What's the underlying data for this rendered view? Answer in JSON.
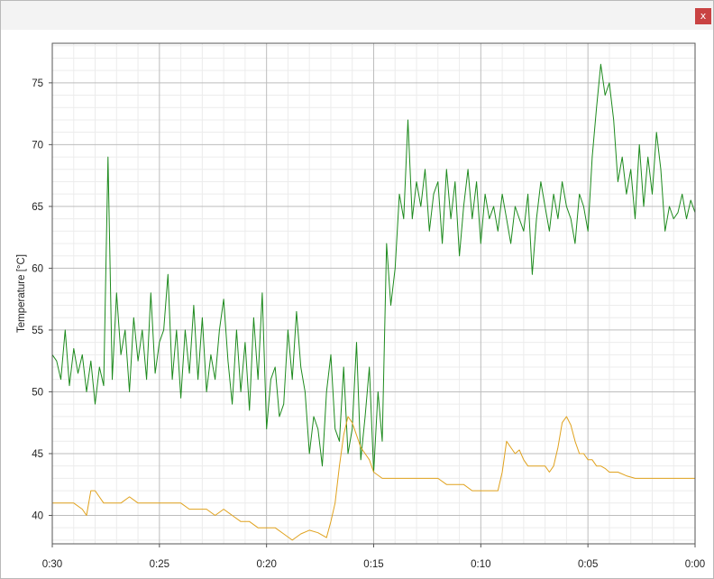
{
  "window": {
    "close_label": "x"
  },
  "colors": {
    "green_series": "#1d8a1d",
    "orange_series": "#e0a21e",
    "grid_major": "#bdbdbd",
    "grid_minor": "#ececec",
    "plot_border": "#555555"
  },
  "chart_data": {
    "type": "line",
    "title": "",
    "xlabel": "",
    "ylabel": "Temperature [°C]",
    "x_reversed": true,
    "xlim": [
      30,
      0
    ],
    "ylim": [
      37.7,
      78.2
    ],
    "x_ticks": [
      30,
      25,
      20,
      15,
      10,
      5,
      0
    ],
    "x_tick_labels": [
      "0:30",
      "0:25",
      "0:20",
      "0:15",
      "0:10",
      "0:05",
      "0:00"
    ],
    "y_ticks": [
      40,
      45,
      50,
      55,
      60,
      65,
      70,
      75
    ],
    "y_tick_labels": [
      "40",
      "45",
      "50",
      "55",
      "60",
      "65",
      "70",
      "75"
    ],
    "grid": true,
    "series": [
      {
        "color": "#1d8a1d",
        "x": [
          30,
          29.8,
          29.6,
          29.4,
          29.2,
          29.0,
          28.8,
          28.6,
          28.4,
          28.2,
          28.0,
          27.8,
          27.6,
          27.4,
          27.2,
          27.0,
          26.8,
          26.6,
          26.4,
          26.2,
          26.0,
          25.8,
          25.6,
          25.4,
          25.2,
          25.0,
          24.8,
          24.6,
          24.4,
          24.2,
          24.0,
          23.8,
          23.6,
          23.4,
          23.2,
          23.0,
          22.8,
          22.6,
          22.4,
          22.2,
          22.0,
          21.8,
          21.6,
          21.4,
          21.2,
          21.0,
          20.8,
          20.6,
          20.4,
          20.2,
          20.0,
          19.8,
          19.6,
          19.4,
          19.2,
          19.0,
          18.8,
          18.6,
          18.4,
          18.2,
          18.0,
          17.8,
          17.6,
          17.4,
          17.2,
          17.0,
          16.8,
          16.6,
          16.4,
          16.2,
          16.0,
          15.8,
          15.6,
          15.4,
          15.2,
          15.0,
          14.8,
          14.6,
          14.4,
          14.2,
          14.0,
          13.8,
          13.6,
          13.4,
          13.2,
          13.0,
          12.8,
          12.6,
          12.4,
          12.2,
          12.0,
          11.8,
          11.6,
          11.4,
          11.2,
          11.0,
          10.8,
          10.6,
          10.4,
          10.2,
          10.0,
          9.8,
          9.6,
          9.4,
          9.2,
          9.0,
          8.8,
          8.6,
          8.4,
          8.2,
          8.0,
          7.8,
          7.6,
          7.4,
          7.2,
          7.0,
          6.8,
          6.6,
          6.4,
          6.2,
          6.0,
          5.8,
          5.6,
          5.4,
          5.2,
          5.0,
          4.8,
          4.6,
          4.4,
          4.2,
          4.0,
          3.8,
          3.6,
          3.4,
          3.2,
          3.0,
          2.8,
          2.6,
          2.4,
          2.2,
          2.0,
          1.8,
          1.6,
          1.4,
          1.2,
          1.0,
          0.8,
          0.6,
          0.4,
          0.2,
          0.0
        ],
        "y": [
          53,
          52.5,
          51,
          55,
          50.5,
          53.5,
          51.5,
          53,
          50,
          52.5,
          49,
          52,
          50.5,
          69,
          51,
          58,
          53,
          55,
          50,
          56,
          52.5,
          55,
          51,
          58,
          51.5,
          54,
          55,
          59.5,
          51,
          55,
          49.5,
          55,
          51.5,
          57,
          51,
          56,
          50,
          53,
          51,
          55,
          57.5,
          52.5,
          49,
          55,
          50,
          54,
          48.5,
          56,
          51,
          58,
          47,
          51,
          52,
          48,
          49,
          55,
          51,
          56.5,
          52,
          50,
          45,
          48,
          47,
          44,
          50,
          53,
          47,
          46,
          52,
          45,
          47,
          54,
          44.5,
          48,
          52,
          43.5,
          50,
          46,
          62,
          57,
          60,
          66,
          64,
          72,
          64,
          67,
          65,
          68,
          63,
          66,
          67,
          62,
          68,
          64,
          67,
          61,
          65,
          68,
          64,
          67,
          62,
          66,
          64,
          65,
          63,
          66,
          64,
          62,
          65,
          64,
          63,
          66,
          59.5,
          64,
          67,
          65,
          63,
          66,
          64,
          67,
          65,
          64,
          62,
          66,
          65,
          63,
          69,
          73,
          76.5,
          74,
          75,
          72,
          67,
          69,
          66,
          68,
          64,
          70,
          65,
          69,
          66,
          71,
          68,
          63,
          65,
          64,
          64.5,
          66,
          64,
          65.5,
          64.5
        ]
      },
      {
        "color": "#e0a21e",
        "x": [
          30,
          29.5,
          29.0,
          28.6,
          28.4,
          28.2,
          28.0,
          27.6,
          27.2,
          26.8,
          26.4,
          26.0,
          25.6,
          25.2,
          24.8,
          24.4,
          24.0,
          23.6,
          23.2,
          22.8,
          22.4,
          22.0,
          21.6,
          21.2,
          20.8,
          20.4,
          20.0,
          19.6,
          19.2,
          18.8,
          18.4,
          18.0,
          17.6,
          17.2,
          17.0,
          16.8,
          16.6,
          16.4,
          16.2,
          16.0,
          15.8,
          15.6,
          15.4,
          15.2,
          15.0,
          14.6,
          14.0,
          13.6,
          13.2,
          12.8,
          12.4,
          12.0,
          11.6,
          11.2,
          10.8,
          10.4,
          10.0,
          9.6,
          9.2,
          9.0,
          8.8,
          8.6,
          8.4,
          8.2,
          8.0,
          7.8,
          7.6,
          7.4,
          7.2,
          7.0,
          6.8,
          6.6,
          6.4,
          6.2,
          6.0,
          5.8,
          5.6,
          5.4,
          5.2,
          5.0,
          4.8,
          4.6,
          4.4,
          4.2,
          4.0,
          3.6,
          3.2,
          2.8,
          2.4,
          2.0,
          1.6,
          1.2,
          0.8,
          0.4,
          0.0
        ],
        "y": [
          41,
          41,
          41,
          40.5,
          40,
          42,
          42,
          41,
          41,
          41,
          41.5,
          41,
          41,
          41,
          41,
          41,
          41,
          40.5,
          40.5,
          40.5,
          40,
          40.5,
          40,
          39.5,
          39.5,
          39,
          39,
          39,
          38.5,
          38,
          38.5,
          38.8,
          38.6,
          38.2,
          39.5,
          41,
          44,
          46.5,
          48,
          47.5,
          46.5,
          45.5,
          45,
          44.5,
          43.5,
          43,
          43,
          43,
          43,
          43,
          43,
          43,
          42.5,
          42.5,
          42.5,
          42,
          42,
          42,
          42,
          43.5,
          46,
          45.5,
          45,
          45.3,
          44.5,
          44,
          44,
          44,
          44,
          44,
          43.5,
          44,
          45.5,
          47.5,
          48,
          47.3,
          46,
          45,
          45,
          44.5,
          44.5,
          44,
          44,
          43.8,
          43.5,
          43.5,
          43.2,
          43,
          43,
          43,
          43,
          43,
          43,
          43,
          43
        ]
      }
    ]
  }
}
